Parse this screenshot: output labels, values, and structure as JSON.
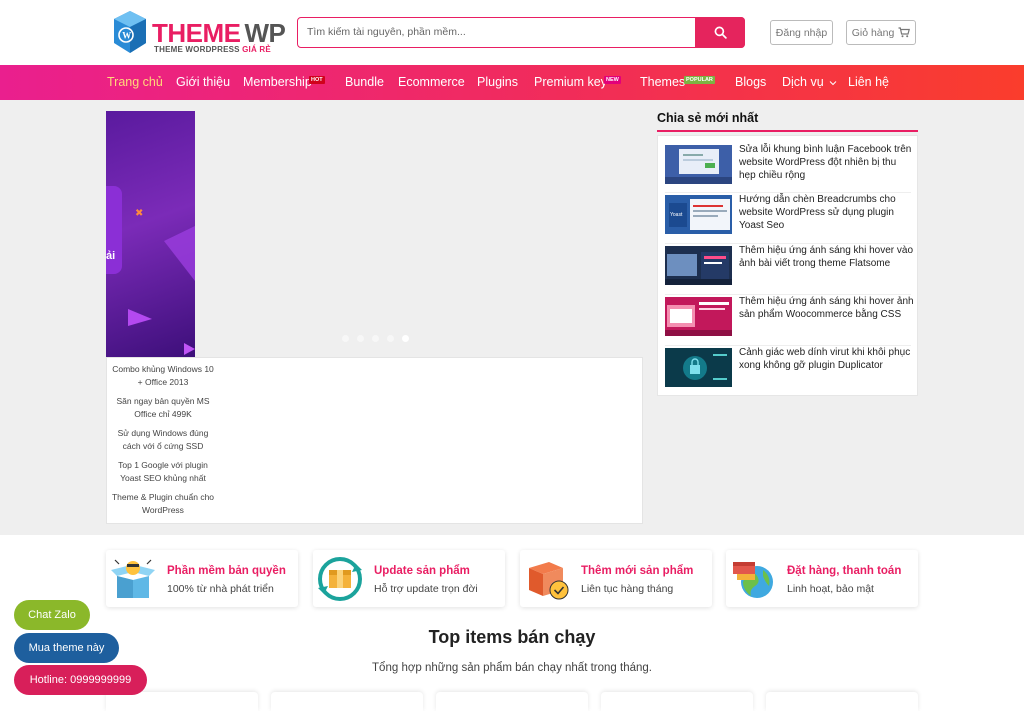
{
  "header": {
    "logo_title_theme": "THEME",
    "logo_title_wp": "WP",
    "logo_sub": "THEME WORDPRESS",
    "logo_sub_red": "GIÁ RẺ",
    "search_placeholder": "Tìm kiếm tài nguyên, phần mềm...",
    "login_label": "Đăng nhập",
    "cart_label": "Giỏ hàng"
  },
  "nav": {
    "items": [
      {
        "label": "Trang chủ"
      },
      {
        "label": "Giới thiệu"
      },
      {
        "label": "Membership",
        "badge": "HOT"
      },
      {
        "label": "Bundle"
      },
      {
        "label": "Ecommerce"
      },
      {
        "label": "Plugins"
      },
      {
        "label": "Premium key",
        "badge": "NEW"
      },
      {
        "label": "Themes",
        "badge": "POPULAR"
      },
      {
        "label": "Blogs"
      },
      {
        "label": "Dịch vụ"
      },
      {
        "label": "Liên hệ"
      }
    ]
  },
  "slider": {
    "slide_text": "ải",
    "thumbs": [
      "Combo khủng Windows 10 + Office 2013",
      "Săn ngay bản quyền MS Office chỉ 499K",
      "Sử dụng Windows đúng cách với ổ cứng SSD",
      "Top 1 Google với plugin Yoast SEO khủng nhất",
      "Theme & Plugin chuẩn cho WordPress"
    ],
    "active_dot": 5,
    "dot_count": 5
  },
  "sidebar": {
    "title": "Chia sẻ mới nhất",
    "posts": [
      {
        "title": "Sửa lỗi khung bình luận Facebook trên website WordPress đột nhiên bị thu hẹp chiều rộng"
      },
      {
        "title": "Hướng dẫn chèn Breadcrumbs cho website WordPress sử dụng plugin Yoast Seo"
      },
      {
        "title": "Thêm hiệu ứng ánh sáng khi hover vào ảnh bài viết trong theme Flatsome"
      },
      {
        "title": "Thêm hiệu ứng ánh sáng khi hover ảnh sản phẩm Woocommerce bằng CSS"
      },
      {
        "title": "Cảnh giác web dính virut khi khôi phục xong không gỡ plugin Duplicator"
      }
    ]
  },
  "features": [
    {
      "title": "Phần mềm bản quyền",
      "sub": "100% từ nhà phát triển",
      "icon": "box-icon"
    },
    {
      "title": "Update sản phẩm",
      "sub": "Hỗ trợ update trọn đời",
      "icon": "update-box-icon"
    },
    {
      "title": "Thêm mới sản phẩm",
      "sub": "Liên tục hàng tháng",
      "icon": "new-box-icon"
    },
    {
      "title": "Đặt hàng, thanh toán",
      "sub": "Linh hoạt, bảo mật",
      "icon": "globe-shipping-icon"
    }
  ],
  "section": {
    "title": "Top items bán chạy",
    "sub": "Tổng hợp những sản phẩm bán chạy nhất trong tháng."
  },
  "floating": {
    "zalo": "Chat Zalo",
    "buy": "Mua theme này",
    "hotline": "Hotline: 0999999999"
  },
  "colors": {
    "accent": "#e91e63",
    "nav_start": "#ea1f8e",
    "nav_end": "#fa3d2c",
    "zalo": "#8bb82a",
    "buy": "#1e5f9e",
    "hotline": "#d81f5a"
  }
}
